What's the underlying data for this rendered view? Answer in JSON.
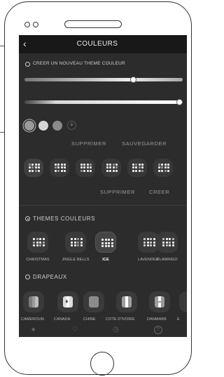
{
  "header": {
    "back_icon": "chevron-left-icon",
    "title": "COULEURS"
  },
  "new_theme": {
    "label": "CREER UN NOUVEAU THEME COULEUR"
  },
  "sliders": [
    {
      "name": "hue-slider",
      "value": 0.69
    },
    {
      "name": "brightness-slider",
      "value": 0.98
    }
  ],
  "swatches": {
    "colors": [
      "#9a9a9a",
      "#d6d6d6",
      "#8a8a8a"
    ],
    "add_symbol": "+"
  },
  "swatch_actions": {
    "delete": "SUPPRIMER",
    "save": "SAUVEGARDER"
  },
  "patterns": {
    "count": 6,
    "selected": 0
  },
  "pattern_actions": {
    "delete": "SUPPRIMER",
    "create": "CREER"
  },
  "themes": {
    "section": "THEMES COULEURS",
    "items": [
      {
        "label": "CHRISTMAS"
      },
      {
        "label": "JINGLE BELLS"
      },
      {
        "label": "ICE"
      },
      {
        "label": "LAVENDER"
      },
      {
        "label": "FLAMINGO"
      }
    ],
    "selected": 2
  },
  "flags": {
    "section": "DRAPEAUX",
    "items": [
      {
        "label": "CAMEROUN",
        "colors": [
          "#7a7a7a",
          "#9a9a9a",
          "#bdbdbd"
        ]
      },
      {
        "label": "CANADA",
        "colors": [
          "#dddddd",
          "#ffffff",
          "#dddddd"
        ]
      },
      {
        "label": "CHINE",
        "colors": [
          "#8c8c8c",
          "#8c8c8c",
          "#8c8c8c"
        ]
      },
      {
        "label": "COTE D'IVOIRE",
        "colors": [
          "#9e9e9e",
          "#ffffff",
          "#9e9e9e"
        ]
      },
      {
        "label": "DANMARK",
        "colors": [
          "#9a9a9a",
          "#ffffff",
          "#9a9a9a"
        ]
      },
      {
        "label": "E"
      }
    ]
  },
  "footer": {
    "icons": [
      "tree-icon",
      "heart-icon",
      "timer-icon",
      "help-icon"
    ]
  }
}
